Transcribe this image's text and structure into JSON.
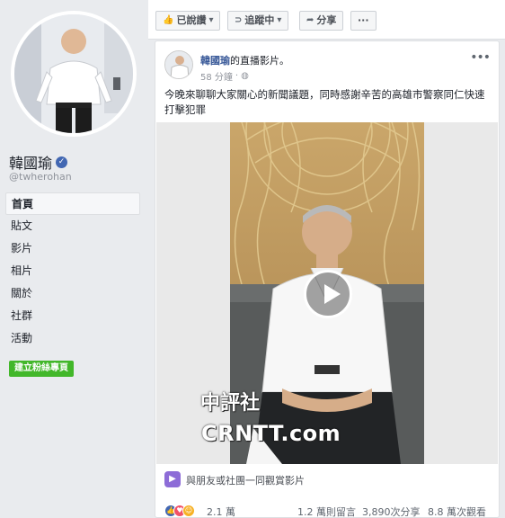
{
  "profile": {
    "name": "韓國瑜",
    "handle": "@twherohan"
  },
  "nav": [
    {
      "label": "首頁",
      "active": true
    },
    {
      "label": "貼文"
    },
    {
      "label": "影片"
    },
    {
      "label": "相片"
    },
    {
      "label": "關於"
    },
    {
      "label": "社群"
    },
    {
      "label": "活動"
    }
  ],
  "create_page_label": "建立粉絲專頁",
  "actionbar": {
    "liked_label": "已說讚",
    "following_label": "追蹤中",
    "share_label": "分享",
    "more_label": "···"
  },
  "post": {
    "author": "韓國瑜",
    "action": "的直播影片。",
    "time": "58 分鐘",
    "text": "今晚來聊聊大家關心的新聞議題，同時感謝辛苦的高雄市警察同仁快速打擊犯罪",
    "watch_together": "與朋友或社團一同觀賞影片",
    "reactions": "2.1 萬",
    "comments": "1.2 萬則留言",
    "shares": "3,890次分享",
    "views": "8.8 萬次觀看"
  },
  "watermark": {
    "line1": "中評社",
    "line2": "CRNTT.com"
  },
  "colors": {
    "brand": "#4267b2",
    "link": "#385898",
    "create_button": "#42b72a",
    "watch_icon": "#8d6cd7"
  }
}
